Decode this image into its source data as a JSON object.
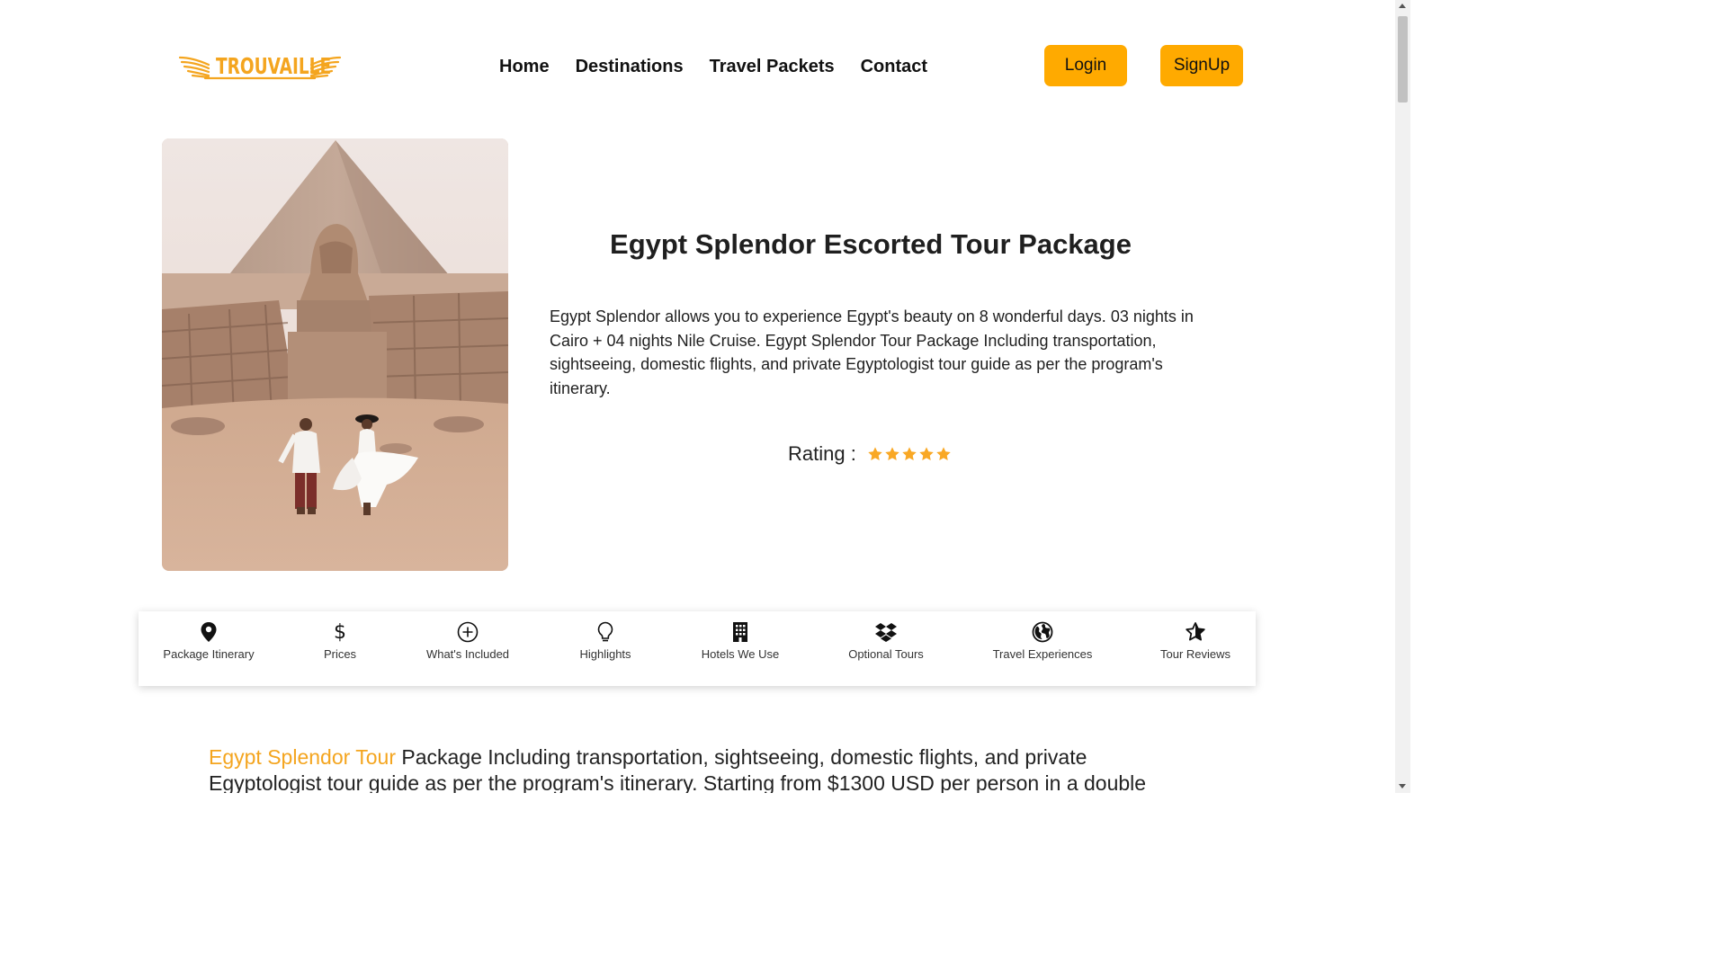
{
  "brand": {
    "name": "TROUVAILLE",
    "accent_color": "#f4a51f",
    "button_color": "#ffaa00"
  },
  "nav": {
    "items": [
      {
        "label": "Home"
      },
      {
        "label": "Destinations"
      },
      {
        "label": "Travel Packets"
      },
      {
        "label": "Contact"
      }
    ]
  },
  "auth": {
    "login_label": "Login",
    "signup_label": "SignUp"
  },
  "hero": {
    "image": "pyramid-sphinx-couple-photo",
    "title": "Egypt Splendor Escorted Tour Package",
    "description": "Egypt Splendor allows you to experience Egypt's beauty on 8 wonderful days. 03 nights in Cairo + 04 nights Nile Cruise. Egypt Splendor Tour Package Including transportation, sightseeing, domestic flights, and private Egyptologist tour guide as per the program's itinerary.",
    "rating_label": "Rating :",
    "rating_value": 5,
    "rating_max": 5,
    "star_color": "#f9a825"
  },
  "tabs": [
    {
      "label": "Package Itinerary",
      "icon": "map-pin-icon"
    },
    {
      "label": "Prices",
      "icon": "dollar-icon"
    },
    {
      "label": "What's Included",
      "icon": "plus-circle-icon"
    },
    {
      "label": "Highlights",
      "icon": "lightbulb-icon"
    },
    {
      "label": "Hotels We Use",
      "icon": "building-icon"
    },
    {
      "label": "Optional Tours",
      "icon": "dropbox-icon"
    },
    {
      "label": "Travel Experiences",
      "icon": "globe-icon"
    },
    {
      "label": "Tour Reviews",
      "icon": "star-icon"
    }
  ],
  "summary": {
    "highlight": "Egypt Splendor Tour",
    "text": " Package Including transportation, sightseeing, domestic flights, and private Egyptologist tour guide as per the program's itinerary. Starting from $1300 USD per person in a double"
  }
}
